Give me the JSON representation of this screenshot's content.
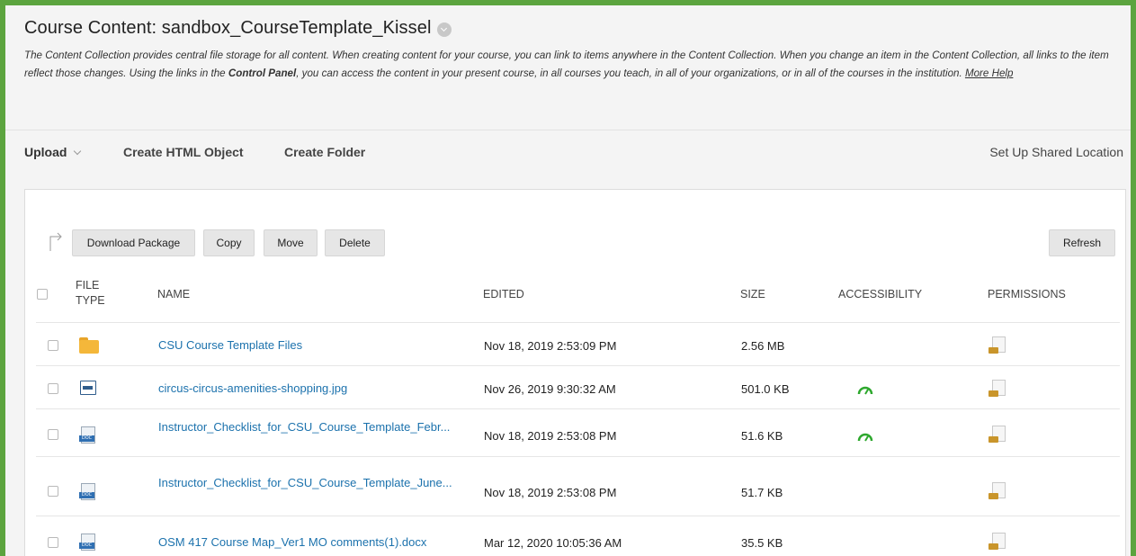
{
  "header": {
    "title": "Course Content: sandbox_CourseTemplate_Kissel",
    "desc_part1": "The Content Collection provides central file storage for all content. When creating content for your course, you can link to items anywhere in the Content Collection. When you change an item in the Content Collection, all links to the item reflect those changes. Using the links in the ",
    "desc_bold": "Control Panel",
    "desc_part2": ", you can access the content in your present course, in all courses you teach, in all of your organizations, or in all of the courses in the institution. ",
    "more_help": "More Help"
  },
  "actionbar": {
    "upload": "Upload",
    "create_html": "Create HTML Object",
    "create_folder": "Create Folder",
    "shared_location": "Set Up Shared Location"
  },
  "buttons": {
    "download": "Download Package",
    "copy": "Copy",
    "move": "Move",
    "delete": "Delete",
    "refresh": "Refresh"
  },
  "columns": {
    "file_type_1": "File",
    "file_type_2": "Type",
    "name": "Name",
    "edited": "Edited",
    "size": "Size",
    "accessibility": "Accessibility",
    "permissions": "Permissions"
  },
  "colors": {
    "frame_border": "#5ca43f",
    "link": "#1c72ad",
    "accessibility_good": "#2ea82e"
  },
  "rows": [
    {
      "type_icon": "folder-icon",
      "name": "CSU Course Template Files",
      "edited": "Nov 18, 2019 2:53:09 PM",
      "size": "2.56 MB",
      "accessibility": false
    },
    {
      "type_icon": "image-file-icon",
      "name": "circus-circus-amenities-shopping.jpg",
      "edited": "Nov 26, 2019 9:30:32 AM",
      "size": "501.0 KB",
      "accessibility": true
    },
    {
      "type_icon": "doc-file-icon",
      "name": "Instructor_Checklist_for_CSU_Course_Template_Febr...",
      "edited": "Nov 18, 2019 2:53:08 PM",
      "size": "51.6 KB",
      "accessibility": true
    },
    {
      "type_icon": "doc-file-icon",
      "name": "Instructor_Checklist_for_CSU_Course_Template_June...",
      "edited": "Nov 18, 2019 2:53:08 PM",
      "size": "51.7 KB",
      "accessibility": false
    },
    {
      "type_icon": "doc-file-icon",
      "name": "OSM 417 Course Map_Ver1 MO comments(1).docx",
      "edited": "Mar 12, 2020 10:05:36 AM",
      "size": "35.5 KB",
      "accessibility": false
    }
  ]
}
